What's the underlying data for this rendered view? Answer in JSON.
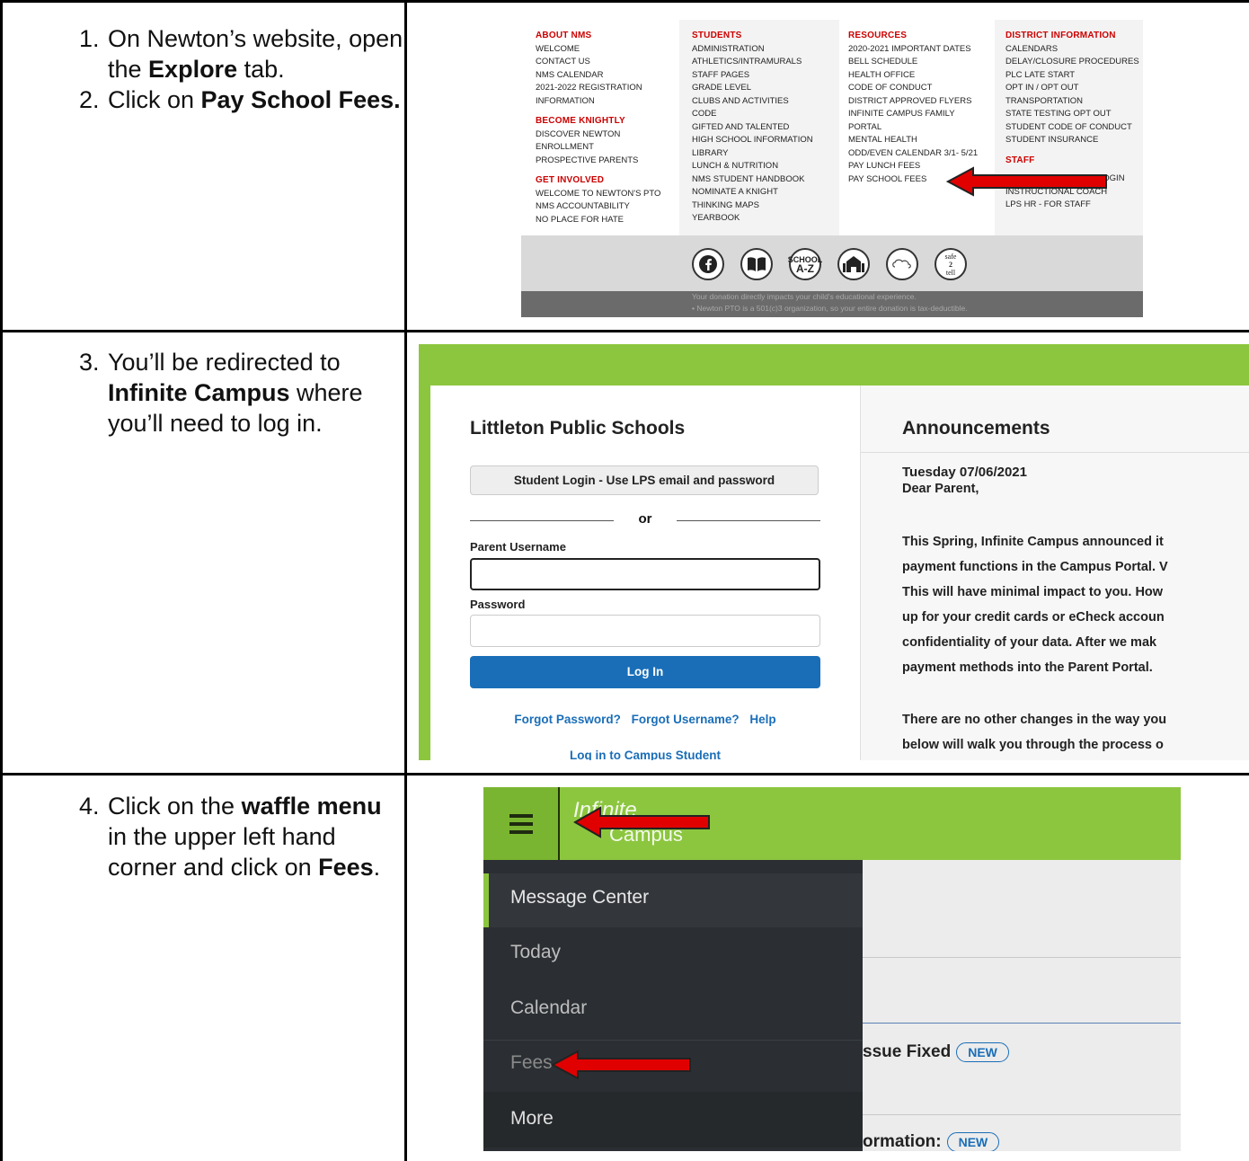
{
  "step1": {
    "items": [
      {
        "pre": "On Newton’s website, open the ",
        "bold": "Explore",
        "post": " tab."
      },
      {
        "pre": "Click on ",
        "bold": "Pay School Fees.",
        "post": ""
      }
    ]
  },
  "step3": {
    "items": [
      {
        "pre": "You’ll be redirected to ",
        "bold": "Infinite Campus",
        "post": " where you’ll need to log in."
      }
    ]
  },
  "step4": {
    "items": [
      {
        "pre": "Click on the ",
        "bold": "waffle menu",
        "post": " in the upper left hand corner and click on ",
        "bold2": "Fees",
        "post2": "."
      }
    ]
  },
  "nms_menu": {
    "about": {
      "heading": "ABOUT NMS",
      "items": [
        "WELCOME",
        "CONTACT US",
        "NMS CALENDAR",
        "2021-2022 REGISTRATION",
        "INFORMATION"
      ]
    },
    "knightly": {
      "heading": "BECOME KNIGHTLY",
      "items": [
        "DISCOVER NEWTON",
        "ENROLLMENT",
        "PROSPECTIVE PARENTS"
      ]
    },
    "involved": {
      "heading": "GET INVOLVED",
      "items": [
        "WELCOME TO NEWTON'S PTO",
        "NMS ACCOUNTABILITY",
        "NO PLACE FOR HATE"
      ]
    },
    "students": {
      "heading": "STUDENTS",
      "items": [
        "ADMINISTRATION",
        "ATHLETICS/INTRAMURALS",
        "STAFF PAGES",
        "GRADE LEVEL",
        "CLUBS AND ACTIVITIES",
        "CODE",
        "GIFTED AND TALENTED",
        "HIGH SCHOOL INFORMATION",
        "LIBRARY",
        "LUNCH & NUTRITION",
        "NMS STUDENT HANDBOOK",
        "NOMINATE A KNIGHT",
        "THINKING MAPS",
        "YEARBOOK"
      ]
    },
    "resources": {
      "heading": "RESOURCES",
      "items": [
        "2020-2021 IMPORTANT DATES",
        "BELL SCHEDULE",
        "HEALTH OFFICE",
        "CODE OF CONDUCT",
        "DISTRICT APPROVED FLYERS",
        "INFINITE CAMPUS FAMILY",
        "PORTAL",
        "MENTAL HEALTH",
        "ODD/EVEN CALENDAR 3/1- 5/21",
        "PAY LUNCH FEES",
        "PAY SCHOOL FEES"
      ]
    },
    "district": {
      "heading": "DISTRICT INFORMATION",
      "items": [
        "CALENDARS",
        "DELAY/CLOSURE PROCEDURES",
        "PLC LATE START",
        "OPT IN / OPT OUT",
        "TRANSPORTATION",
        "STATE TESTING OPT OUT",
        "STUDENT CODE OF CONDUCT",
        "STUDENT INSURANCE"
      ]
    },
    "staff": {
      "heading": "STAFF",
      "items": [
        "LOGIN",
        "INSTRUCTIONAL COACH",
        "LPS HR - FOR STAFF"
      ]
    },
    "icons": [
      "facebook-icon",
      "book-icon",
      "school-az-icon",
      "school-building-icon",
      "cloud-link-icon",
      "safe2tell-icon"
    ],
    "icon_text": {
      "school_top": "SCHOOL",
      "school_bottom": "A-Z",
      "safe": "safe",
      "tell": "tell"
    },
    "footer": [
      "Your donation directly impacts your child's educational experience.",
      "• Newton PTO is a 501(c)3 organization, so your entire donation is tax-deductible."
    ]
  },
  "login": {
    "title": "Littleton Public Schools",
    "student_button": "Student Login - Use LPS email and password",
    "or": "or",
    "username_label": "Parent Username",
    "password_label": "Password",
    "login_button": "Log In",
    "links": [
      "Forgot Password?",
      "Forgot Username?",
      "Help"
    ],
    "campus_student": "Log in to Campus Student"
  },
  "announcements": {
    "title": "Announcements",
    "date": "Tuesday 07/06/2021",
    "greeting": "Dear Parent,",
    "lines": [
      "This Spring, Infinite Campus announced it",
      "payment functions in the Campus Portal. V",
      "This will have minimal impact to you. How",
      "up for your credit cards or eCheck accoun",
      "confidentiality of your data.  After we mak",
      "payment methods into the Parent Portal."
    ],
    "lines2": [
      "There are no other changes in the way you",
      "below will walk you through the process o"
    ]
  },
  "campus": {
    "logo_top": "Infinite",
    "logo_bottom": "Campus",
    "menu": [
      "Message Center",
      "Today",
      "Calendar",
      "Fees",
      "More"
    ],
    "main": {
      "line1": "ssue Fixed",
      "line2": "ormation:",
      "badge": "NEW"
    }
  },
  "colors": {
    "green": "#8cc63f",
    "blue": "#1a6eb8",
    "red_arrow": "#e00000",
    "menu_heading": "#cc0000"
  }
}
